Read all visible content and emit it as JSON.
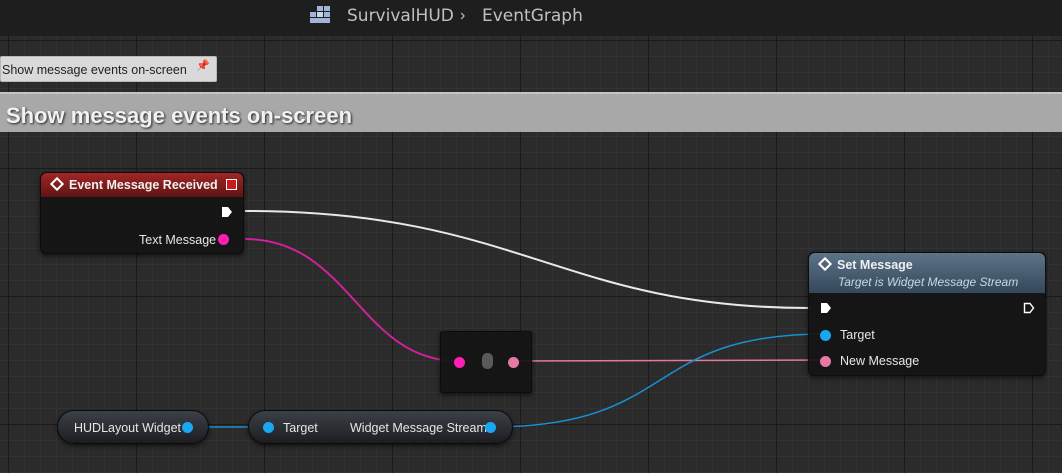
{
  "breadcrumb": {
    "icon": "blueprint-icon",
    "blueprint": "SurvivalHUD",
    "separator": "›",
    "graph": "EventGraph"
  },
  "tooltip": {
    "text": "Show message events on-screen",
    "icon": "pin-icon"
  },
  "comment": {
    "title": "Show message events on-screen",
    "color": "#a8a8a8"
  },
  "event_node": {
    "title": "Event Message Received",
    "pins": {
      "text_message": "Text Message"
    },
    "color": "#a12626"
  },
  "set_message_node": {
    "title": "Set Message",
    "subtitle": "Target is Widget Message Stream",
    "pins": {
      "target": "Target",
      "new_message": "New Message"
    },
    "color": "#4e657b"
  },
  "hud_layout_node": {
    "label": "HUDLayout Widget"
  },
  "stream_node": {
    "target_label": "Target",
    "output_label": "Widget Message Stream"
  },
  "colors": {
    "exec_wire": "#e8e8e8",
    "text_wire": "#d1209a",
    "object_wire": "#1a8fd1",
    "text_pin": "#ff1fb3",
    "object_pin": "#1aa7f2"
  }
}
